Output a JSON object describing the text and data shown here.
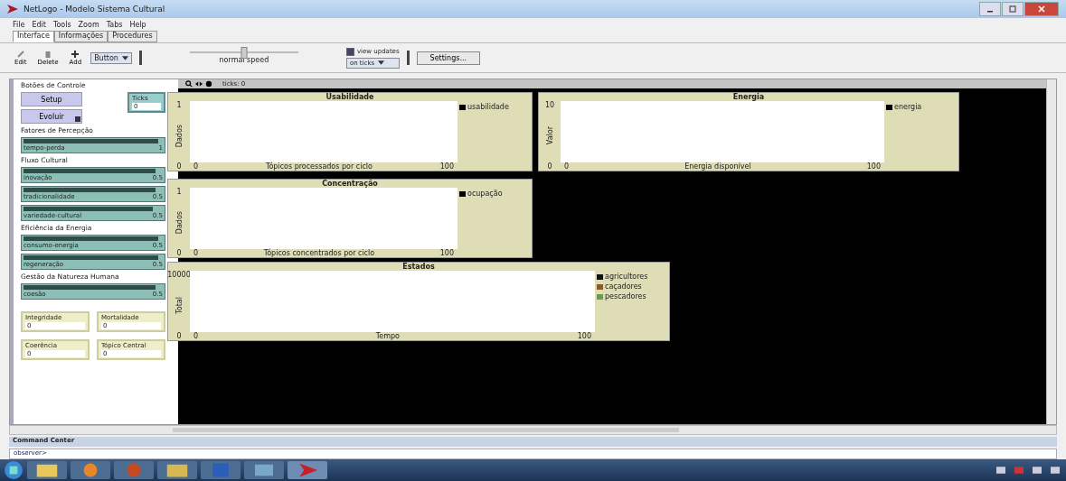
{
  "window": {
    "title": "NetLogo - Modelo Sistema Cultural"
  },
  "menu": [
    "File",
    "Edit",
    "Tools",
    "Zoom",
    "Tabs",
    "Help"
  ],
  "tabs": [
    {
      "label": "Interface",
      "selected": true
    },
    {
      "label": "Informações",
      "selected": false
    },
    {
      "label": "Procedures",
      "selected": false
    }
  ],
  "toolbar": {
    "tools": [
      {
        "label": "Edit",
        "kind": "edit"
      },
      {
        "label": "Delete",
        "kind": "delete"
      },
      {
        "label": "Add",
        "kind": "add"
      }
    ],
    "widget_select": "Button",
    "speed": {
      "label": "normal speed",
      "level": 0.5
    },
    "view_updates": {
      "label": "view updates",
      "checked": true
    },
    "update_mode": "on ticks",
    "settings": "Settings..."
  },
  "view": {
    "ticks_label": "ticks: 0"
  },
  "controls": {
    "heading": "Botões de Controle",
    "buttons": [
      {
        "label": "Setup",
        "forever": false
      },
      {
        "label": "Evoluir",
        "forever": true
      }
    ],
    "monitor": {
      "label": "Ticks",
      "value": "0"
    }
  },
  "slider_groups": [
    {
      "heading": "Fatores de Percepção",
      "sliders": [
        {
          "label": "tempo-perda",
          "value": "1",
          "level": 0.97
        }
      ]
    },
    {
      "heading": "Fluxo Cultural",
      "sliders": [
        {
          "label": "inovação",
          "value": "0.5",
          "level": 0.95
        },
        {
          "label": "tradicionalidade",
          "value": "0.5",
          "level": 0.95
        },
        {
          "label": "variedade-cultural",
          "value": "0.5",
          "level": 0.93
        }
      ]
    },
    {
      "heading": "Eficiência da Energia",
      "sliders": [
        {
          "label": "consumo-energia",
          "value": "0.5",
          "level": 0.97
        },
        {
          "label": "regeneração",
          "value": "0.5",
          "level": 0.97
        }
      ]
    },
    {
      "heading": "Gestão da Natureza Humana",
      "sliders": [
        {
          "label": "coesão",
          "value": "0.5",
          "level": 0.95
        }
      ]
    }
  ],
  "monitors": [
    {
      "label": "Integridade",
      "value": "0"
    },
    {
      "label": "Mortalidade",
      "value": "0"
    },
    {
      "label": "Coerência",
      "value": "0"
    },
    {
      "label": "Tópico Central",
      "value": "0"
    }
  ],
  "plots": [
    {
      "title": "Usabilidade",
      "ylabel": "Dados",
      "xlabel": "Tópicos processados por ciclo",
      "xmin": "0",
      "xmax": "100",
      "ymin": "0",
      "ymax": "1",
      "legend": [
        {
          "label": "usabilidade",
          "color": "#000000"
        }
      ]
    },
    {
      "title": "Energia",
      "ylabel": "Valor",
      "xlabel": "Energia disponível",
      "xmin": "0",
      "xmax": "100",
      "ymin": "0",
      "ymax": "10",
      "legend": [
        {
          "label": "energia",
          "color": "#000000"
        }
      ]
    },
    {
      "title": "Concentração",
      "ylabel": "Dados",
      "xlabel": "Tópicos concentrados por ciclo",
      "xmin": "0",
      "xmax": "100",
      "ymin": "0",
      "ymax": "1",
      "legend": [
        {
          "label": "ocupação",
          "color": "#000000"
        }
      ]
    },
    {
      "title": "Estados",
      "ylabel": "Total",
      "xlabel": "Tempo",
      "xmin": "0",
      "xmax": "100",
      "ymin": "0",
      "ymax": "10000",
      "legend": [
        {
          "label": "agricultores",
          "color": "#111111"
        },
        {
          "label": "caçadores",
          "color": "#8a5a2b"
        },
        {
          "label": "pescadores",
          "color": "#6e9a4e"
        }
      ]
    }
  ],
  "command_center": {
    "title": "Command Center",
    "prompt": "observer>"
  }
}
